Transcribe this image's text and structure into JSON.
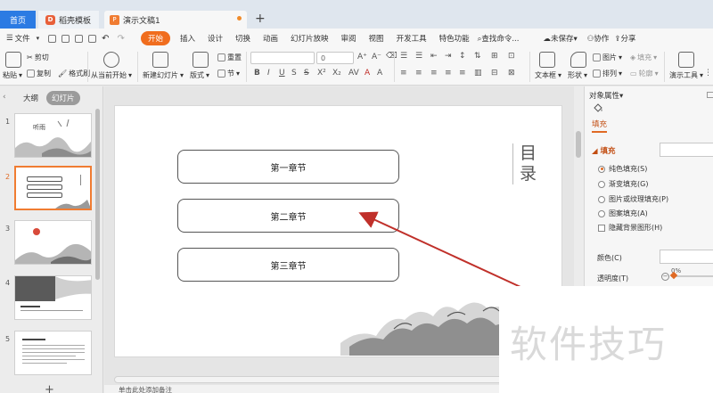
{
  "tabs": {
    "home": "首页",
    "template": "稻壳模板",
    "document": "演示文稿1"
  },
  "menu": {
    "file": "文件",
    "items": [
      "开始",
      "插入",
      "设计",
      "切换",
      "动画",
      "幻灯片放映",
      "审阅",
      "视图",
      "开发工具",
      "特色功能"
    ],
    "search": "查找命令...",
    "unsaved": "未保存",
    "collab": "协作",
    "share": "分享"
  },
  "ribbon": {
    "paste": "粘贴",
    "cut": "剪切",
    "copy": "复制",
    "format_painter": "格式刷",
    "from_current": "从当前开始",
    "new_slide": "新建幻灯片",
    "layout": "版式",
    "section": "节",
    "reset": "重置",
    "font_size": "0",
    "textbox": "文本框",
    "shape": "形状",
    "arrange": "排列",
    "picture": "图片",
    "fill": "填充",
    "outline": "轮廓",
    "present_tools": "演示工具"
  },
  "left_panel": {
    "outline_tab": "大纲",
    "slides_tab": "幻灯片",
    "slide_numbers": [
      "1",
      "2",
      "3",
      "4",
      "5"
    ],
    "thumb1_title": "听雨"
  },
  "slide": {
    "toc_title": "目录",
    "chapters": [
      "第一章节",
      "第二章节",
      "第三章节"
    ]
  },
  "notes": {
    "placeholder": "单击此处添加备注"
  },
  "right_panel": {
    "title": "对象属性",
    "fill_tab": "填充",
    "fill_section": "填充",
    "options": [
      "纯色填充(S)",
      "渐变填充(G)",
      "图片或纹理填充(P)",
      "图案填充(A)"
    ],
    "hide_bg": "隐藏背景图形(H)",
    "color_label": "颜色(C)",
    "transparency_label": "透明度(T)",
    "transparency_value": "0%"
  },
  "watermark": "软件技巧",
  "colors": {
    "accent": "#f06d1e",
    "home_tab": "#2b7be3",
    "arrow": "#c0302a"
  }
}
